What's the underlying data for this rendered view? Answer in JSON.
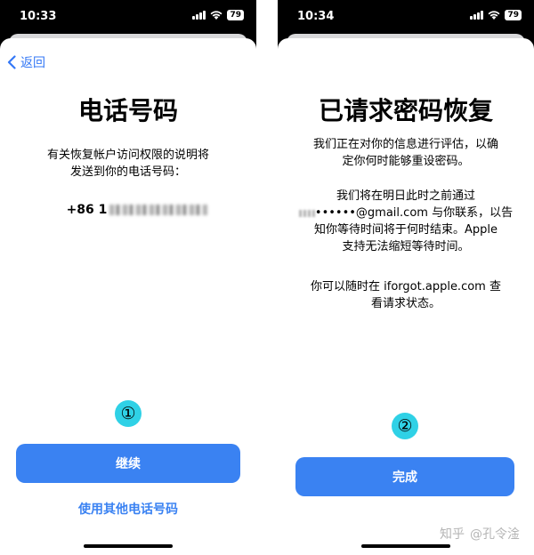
{
  "colors": {
    "accent": "#3478f6",
    "button": "#3a82f2",
    "badge": "#2fd1e6"
  },
  "left": {
    "status_time": "10:33",
    "battery": "79",
    "back_label": "返回",
    "title": "电话号码",
    "description_line1": "有关恢复帐户访问权限的说明将",
    "description_line2": "发送到你的电话号码：",
    "phone_prefix": "+86 1",
    "step_number": "①",
    "continue_label": "继续",
    "other_number_label": "使用其他电话号码"
  },
  "right": {
    "status_time": "10:34",
    "battery": "79",
    "title": "已请求密码恢复",
    "para1_line1": "我们正在对你的信息进行评估，以确",
    "para1_line2": "定你何时能够重设密码。",
    "para2_line1": "我们将在明日此时之前通过",
    "para2_line2": "••••••@gmail.com 与你联系，以告",
    "para2_line3": "知你等待时间将于何时结束。Apple",
    "para2_line4": "支持无法缩短等待时间。",
    "para3_line1": "你可以随时在 iforgot.apple.com 查",
    "para3_line2": "看请求状态。",
    "step_number": "②",
    "done_label": "完成"
  },
  "watermark": {
    "site": "知乎",
    "author": "@孔令淦"
  },
  "icons": [
    "chevron-left-icon",
    "signal-icon",
    "wifi-icon",
    "battery-icon"
  ]
}
